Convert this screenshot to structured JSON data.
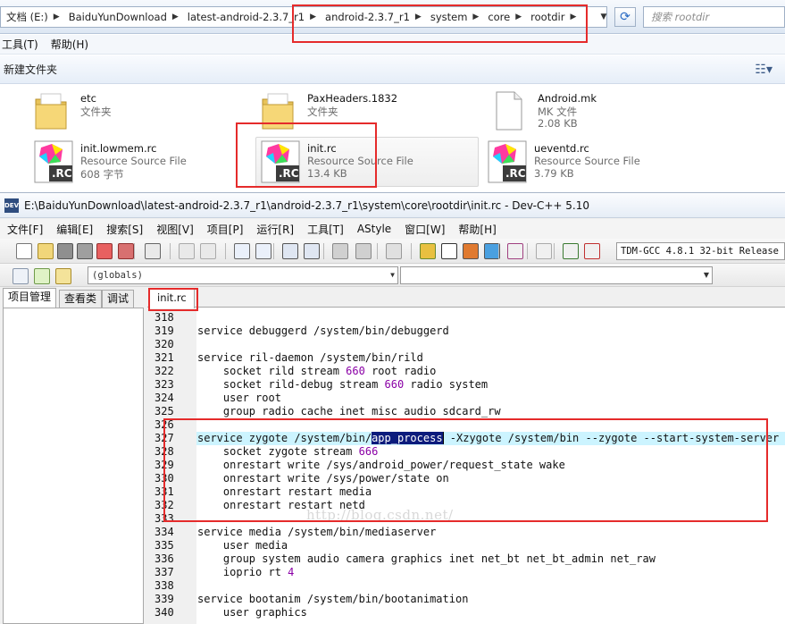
{
  "explorer": {
    "breadcrumbs": [
      "文档 (E:)",
      "BaiduYunDownload",
      "latest-android-2.3.7_r1",
      "android-2.3.7_r1",
      "system",
      "core",
      "rootdir"
    ],
    "search_placeholder": "搜索 rootdir",
    "menu": [
      "工具(T)",
      "帮助(H)"
    ],
    "new_folder": "新建文件夹",
    "files": [
      {
        "name": "etc",
        "type": "文件夹",
        "size": "",
        "icon": "folder-icon"
      },
      {
        "name": "PaxHeaders.1832",
        "type": "文件夹",
        "size": "",
        "icon": "folder-icon"
      },
      {
        "name": "Android.mk",
        "type": "MK 文件",
        "size": "2.08 KB",
        "icon": "document-icon"
      },
      {
        "name": "init.lowmem.rc",
        "type": "Resource Source File",
        "size": "608 字节",
        "icon": "rc-file-icon"
      },
      {
        "name": "init.rc",
        "type": "Resource Source File",
        "size": "13.4 KB",
        "icon": "rc-file-icon"
      },
      {
        "name": "ueventd.rc",
        "type": "Resource Source File",
        "size": "3.79 KB",
        "icon": "rc-file-icon"
      }
    ],
    "rc_badge": ".RC"
  },
  "devcpp": {
    "app_icon_text": "DEV",
    "title": "E:\\BaiduYunDownload\\latest-android-2.3.7_r1\\android-2.3.7_r1\\system\\core\\rootdir\\init.rc - Dev-C++ 5.10",
    "menu": [
      "文件[F]",
      "编辑[E]",
      "搜索[S]",
      "视图[V]",
      "项目[P]",
      "运行[R]",
      "工具[T]",
      "AStyle",
      "窗口[W]",
      "帮助[H]"
    ],
    "compiler": "TDM-GCC 4.8.1 32-bit Release",
    "globals": "(globals)",
    "left_tabs": [
      "项目管理",
      "查看类",
      "调试"
    ],
    "file_tab": "init.rc",
    "watermark": "http://blog.csdn.net/",
    "lines": [
      {
        "n": "318",
        "t": ""
      },
      {
        "n": "319",
        "t": "service debuggerd /system/bin/debuggerd"
      },
      {
        "n": "320",
        "t": ""
      },
      {
        "n": "321",
        "t": "service ril-daemon /system/bin/rild"
      },
      {
        "n": "322",
        "t": "    socket rild stream 660 root radio"
      },
      {
        "n": "323",
        "t": "    socket rild-debug stream 660 radio system"
      },
      {
        "n": "324",
        "t": "    user root"
      },
      {
        "n": "325",
        "t": "    group radio cache inet misc audio sdcard_rw"
      },
      {
        "n": "326",
        "t": ""
      },
      {
        "n": "327",
        "t": "service zygote /system/bin/app_process -Xzygote /system/bin --zygote --start-system-server"
      },
      {
        "n": "328",
        "t": "    socket zygote stream 666"
      },
      {
        "n": "329",
        "t": "    onrestart write /sys/android_power/request_state wake"
      },
      {
        "n": "330",
        "t": "    onrestart write /sys/power/state on"
      },
      {
        "n": "331",
        "t": "    onrestart restart media"
      },
      {
        "n": "332",
        "t": "    onrestart restart netd"
      },
      {
        "n": "333",
        "t": ""
      },
      {
        "n": "334",
        "t": "service media /system/bin/mediaserver"
      },
      {
        "n": "335",
        "t": "    user media"
      },
      {
        "n": "336",
        "t": "    group system audio camera graphics inet net_bt net_bt_admin net_raw"
      },
      {
        "n": "337",
        "t": "    ioprio rt 4"
      },
      {
        "n": "338",
        "t": ""
      },
      {
        "n": "339",
        "t": "service bootanim /system/bin/bootanimation"
      },
      {
        "n": "340",
        "t": "    user graphics"
      }
    ],
    "selected_text": "app_process",
    "current_line": "327"
  },
  "colors": {
    "annotation": "#e52b2b",
    "selection": "#0c1b7c",
    "number": "#8a00a6",
    "current_line": "#ccf4ff"
  }
}
